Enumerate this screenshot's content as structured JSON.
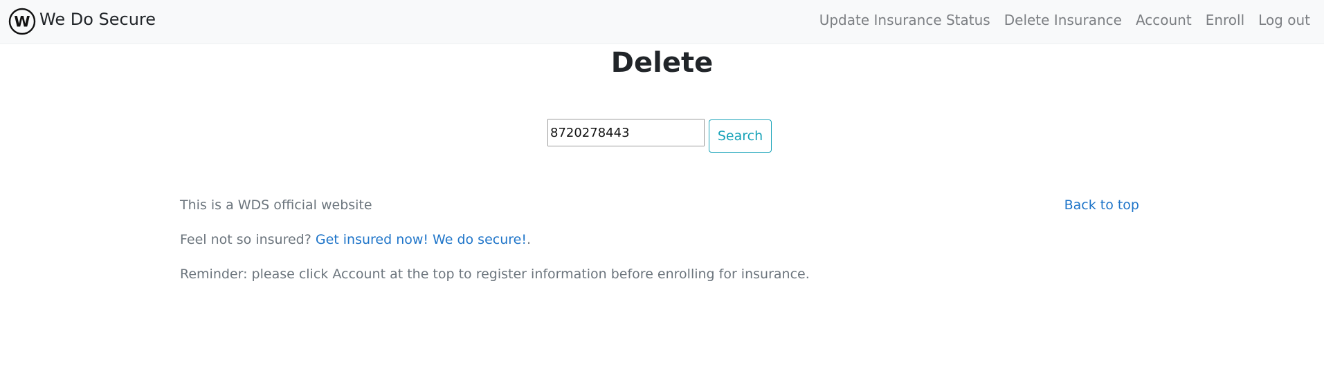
{
  "navbar": {
    "brand_name": "We Do Secure",
    "brand_logo_letter": "W",
    "links": [
      {
        "label": "Update Insurance Status"
      },
      {
        "label": "Delete Insurance"
      },
      {
        "label": "Account"
      },
      {
        "label": "Enroll"
      },
      {
        "label": "Log out"
      }
    ]
  },
  "main": {
    "title": "Delete",
    "search": {
      "value": "8720278443",
      "button_label": "Search"
    }
  },
  "footer": {
    "official_text": "This is a WDS official website",
    "back_to_top": "Back to top",
    "insured_prefix": "Feel not so insured? ",
    "insured_link": "Get insured now! We do secure!",
    "insured_suffix": ".",
    "reminder": "Reminder: please click Account at the top to register information before enrolling for insurance."
  },
  "colors": {
    "navbar_bg": "#f8f9fa",
    "nav_link": "#7c7f83",
    "accent_button": "#17a2b8",
    "link": "#1f75c9",
    "muted_text": "#6c757d"
  }
}
